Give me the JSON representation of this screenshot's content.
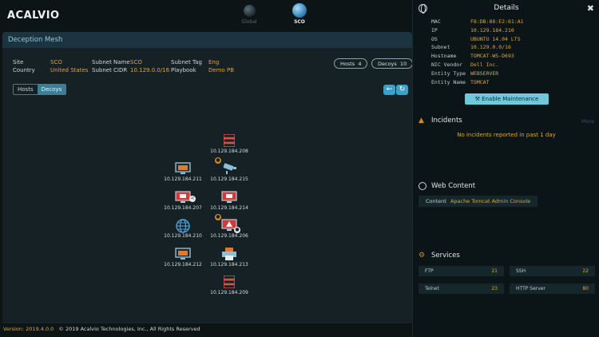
{
  "app": {
    "logo": "ACALVIO"
  },
  "nav": [
    {
      "label": "Global",
      "active": false
    },
    {
      "label": "SCO",
      "active": true
    }
  ],
  "mesh": {
    "title": "Deception Mesh",
    "site_label": "Site",
    "site": "SCO",
    "country_label": "Country",
    "country": "United States",
    "subnet_name_label": "Subnet Name",
    "subnet_name": "SCO",
    "subnet_cidr_label": "Subnet CIDR",
    "subnet_cidr": "10.129.0.0/16",
    "subnet_tag_label": "Subnet Tag",
    "subnet_tag": "Eng",
    "playbook_label": "Playbook",
    "playbook": "Demo PB",
    "hosts_pill": "Hosts",
    "hosts_count": "4",
    "decoys_pill": "Decoys",
    "decoys_count": "10",
    "tab_hosts": "Hosts",
    "tab_decoys": "Decoys",
    "back_icon": "arrow-left-icon",
    "refresh_icon": "refresh-icon"
  },
  "nodes": [
    {
      "ip": "10.129.184.208",
      "icon": "server-icon",
      "color": "#d05545"
    },
    {
      "ip": "10.129.184.211",
      "icon": "monitor-icon",
      "color": "#e07a2e"
    },
    {
      "ip": "10.129.184.215",
      "icon": "camera-icon",
      "color": "#8cc0d8"
    },
    {
      "ip": "10.129.184.207",
      "icon": "monitor-icon",
      "color": "#d03a3a"
    },
    {
      "ip": "10.129.184.214",
      "icon": "monitor-icon",
      "color": "#d03a3a"
    },
    {
      "ip": "10.129.184.210",
      "icon": "globe-icon",
      "color": "#4aa0d8"
    },
    {
      "ip": "10.129.184.206",
      "icon": "warning-monitor-icon",
      "color": "#d03a3a"
    },
    {
      "ip": "10.129.184.212",
      "icon": "monitor-icon",
      "color": "#e07a2e"
    },
    {
      "ip": "10.129.184.213",
      "icon": "printer-icon",
      "color": "#e07a2e"
    },
    {
      "ip": "10.129.184.209",
      "icon": "server-icon",
      "color": "#d05545"
    }
  ],
  "footer": {
    "version": "Version: 2019.4.0.0",
    "copyright": "© 2019 Acalvio Technologies, Inc., All Rights Reserved"
  },
  "details": {
    "title": "Details",
    "rows": [
      {
        "k": "MAC",
        "v": "F8:DB:88:E2:61:A1"
      },
      {
        "k": "IP",
        "v": "10.129.184.210"
      },
      {
        "k": "OS",
        "v": "UBUNTU 14.04 LTS"
      },
      {
        "k": "Subnet",
        "v": "10.129.0.0/16"
      },
      {
        "k": "Hostname",
        "v": "TOMCAT-WS-D693"
      },
      {
        "k": "NIC Vendor",
        "v": "Dell Inc."
      },
      {
        "k": "Entity Type",
        "v": "WEBSERVER"
      },
      {
        "k": "Entity Name",
        "v": "TOMCAT"
      }
    ],
    "maintenance_button": "Enable Maintenance",
    "incidents_title": "Incidents",
    "incidents_more": "More",
    "incidents_msg": "No incidents reported in past 1 day",
    "web_title": "Web Content",
    "web_key": "Content",
    "web_value": "Apache Tomcat Admin Console",
    "services_title": "Services",
    "services": [
      {
        "name": "FTP",
        "port": "21"
      },
      {
        "name": "SSH",
        "port": "22"
      },
      {
        "name": "Telnet",
        "port": "23"
      },
      {
        "name": "HTTP Server",
        "port": "80"
      }
    ]
  }
}
